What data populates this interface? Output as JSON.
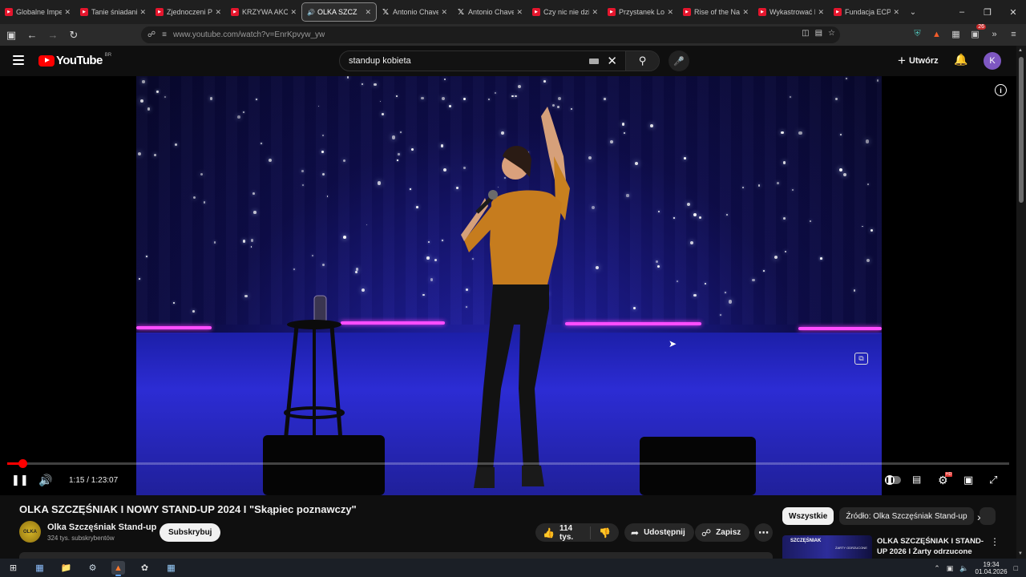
{
  "browser": {
    "tabs": [
      {
        "title": "Globalne Imperi",
        "icon": "youtube-favicon"
      },
      {
        "title": "Tanie śniadanie",
        "icon": "youtube-favicon"
      },
      {
        "title": "Zjednoczeni Prz",
        "icon": "youtube-favicon"
      },
      {
        "title": "KRZYWA AKCJA",
        "icon": "youtube-favicon"
      },
      {
        "title": "OLKA SZCZ",
        "icon": "speaker-icon",
        "active": true
      },
      {
        "title": "Antonio Chavez",
        "icon": "x-favicon"
      },
      {
        "title": "Antonio Chavez",
        "icon": "x-favicon"
      },
      {
        "title": "Czy nic nie dziej",
        "icon": "youtube-favicon"
      },
      {
        "title": "Przystanek Lomi",
        "icon": "youtube-favicon"
      },
      {
        "title": "Rise of the Nazi",
        "icon": "youtube-favicon"
      },
      {
        "title": "Wykastrować bi",
        "icon": "youtube-favicon"
      },
      {
        "title": "Fundacja ECPU",
        "icon": "youtube-favicon"
      }
    ],
    "url": "www.youtube.com/watch?v=EnrKpvyw_yw",
    "extension_badge": "26"
  },
  "youtube": {
    "logo_text": "YouTube",
    "region": "BR",
    "search_query": "standup kobieta",
    "create_label": "Utwórz",
    "avatar_letter": "K"
  },
  "player": {
    "current_time": "1:15",
    "duration": "1:23:07",
    "time_display": "1:15 / 1:23:07",
    "progress_fraction": 0.015,
    "state": "playing"
  },
  "video": {
    "title": "OLKA SZCZĘŚNIAK I NOWY STAND-UP 2024 I \"Skąpiec poznawczy\"",
    "channel": "Olka Szczęśniak Stand-up",
    "channel_avatar_text": "OLKA",
    "subscribers": "324 tys. subskrybentów",
    "subscribe_label": "Subskrybuj",
    "likes": "114 tys.",
    "share_label": "Udostępnij",
    "save_label": "Zapisz"
  },
  "sidebar": {
    "chips": [
      "Wszystkie",
      "Źródło: Olka Szczęśniak Stand-up"
    ],
    "recommendation": {
      "title": "OLKA SZCZĘŚNIAK I STAND-UP 2026 I Żarty odrzucone",
      "thumb_text": "SZCZĘŚNIAK",
      "thumb_sub": "ŻARTY ODRZUCONE"
    }
  },
  "taskbar": {
    "time": "19:34",
    "date": "01.04.2026"
  }
}
